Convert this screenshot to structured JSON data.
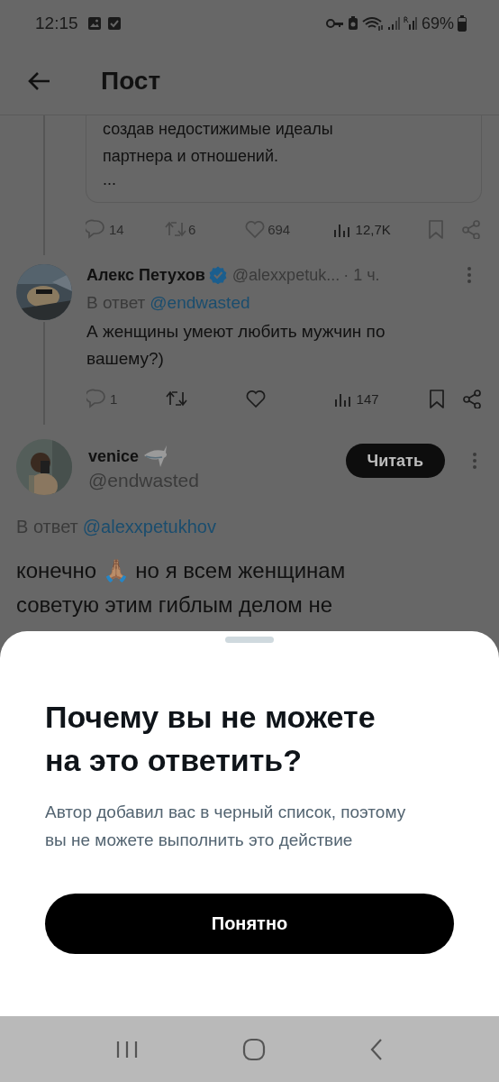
{
  "status_bar": {
    "time": "12:15",
    "battery": "69%"
  },
  "header": {
    "title": "Пост"
  },
  "quoted_card": {
    "text": "создав недостижимые идеалы\nпартнера и отношений.",
    "more": "..."
  },
  "quoted_actions": [
    {
      "kind": "reply",
      "count": "14",
      "disabled": true
    },
    {
      "kind": "repost",
      "count": "6",
      "disabled": true
    },
    {
      "kind": "like",
      "count": "694",
      "disabled": true
    },
    {
      "kind": "views",
      "count": "12,7K",
      "disabled": false
    },
    {
      "kind": "bookmark",
      "disabled": true
    },
    {
      "kind": "share",
      "disabled": true
    }
  ],
  "tweets": [
    {
      "name": "Алекс Петухов",
      "verified": true,
      "handle": "@alexxpetuk...",
      "time": "· 1 ч.",
      "reply_label": "В ответ",
      "reply_to": "@endwasted",
      "text": "А женщины умеют любить мужчин по вашему?)",
      "actions": [
        {
          "kind": "reply",
          "count": "1",
          "disabled": true
        },
        {
          "kind": "repost",
          "disabled": false
        },
        {
          "kind": "like",
          "disabled": false
        },
        {
          "kind": "views",
          "count": "147",
          "disabled": false
        },
        {
          "kind": "bookmark",
          "disabled": false
        },
        {
          "kind": "share",
          "disabled": false
        }
      ]
    },
    {
      "name": "venice",
      "handle": "@endwasted",
      "follow_button": "Читать",
      "reply_label": "В ответ",
      "reply_to": "@alexxpetukhov",
      "text": "конечно 🙏🏽 но я всем женщинам советую этим гиблым делом не"
    }
  ],
  "sheet": {
    "title": "Почему вы не можете на это ответить?",
    "description": "Автор добавил вас в черный список, поэтому вы не можете выполнить это действие",
    "button": "Понятно"
  }
}
